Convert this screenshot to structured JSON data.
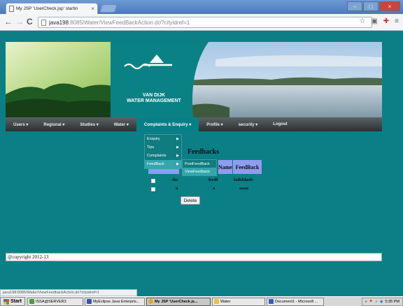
{
  "browser": {
    "tab_title": "My JSP 'UserCheck.jsp' startin",
    "tab_close": "×",
    "window_buttons": [
      "–",
      "□",
      "×"
    ],
    "nav": {
      "back": "←",
      "forward": "→",
      "reload": "C"
    },
    "url_host": "java198",
    "url_rest": ":8085/Water/ViewFeedBackAction.do?cityidref=1",
    "toolbar_icons": [
      "☆",
      "▣",
      "✚",
      "≡"
    ]
  },
  "logo": {
    "line1": "VAN DIJK",
    "line2": "WATER MANAGEMENT"
  },
  "menu": [
    {
      "label": "Users ▾",
      "active": false
    },
    {
      "label": "Regional ▾",
      "active": false
    },
    {
      "label": "Studies ▾",
      "active": false
    },
    {
      "label": "Water ▾",
      "active": false
    },
    {
      "label": "Complaints & Enquiry ▾",
      "active": true
    },
    {
      "label": "Profile ▾",
      "active": false
    },
    {
      "label": "security ▾",
      "active": false
    },
    {
      "label": "Logout",
      "active": false
    }
  ],
  "dropdown": [
    {
      "label": "Enquiry",
      "arrow": "▶"
    },
    {
      "label": "Tips",
      "arrow": "▶"
    },
    {
      "label": "Complaints",
      "arrow": "▶"
    },
    {
      "label": "FeedBack",
      "arrow": "▶"
    }
  ],
  "submenu": [
    {
      "label": "PostFeedBack"
    },
    {
      "label": "ViewFeedback"
    }
  ],
  "feedback": {
    "title": "Feedbacks",
    "headers": [
      "FeedBack",
      "Name",
      "FeedBack"
    ],
    "rows": [
      {
        "col1": "dss",
        "name": "fsedf",
        "feedback": "fadsfdasfs"
      },
      {
        "col1": "a",
        "name": "a",
        "feedback": "aaaa"
      }
    ],
    "delete_label": "Delete"
  },
  "footer": {
    "copyright": "@copyright 2012-13"
  },
  "status_url": "java198:8085/Water/ViewFeedbackAction.do?cityidref=1",
  "taskbar": {
    "start": "Start",
    "tasks": [
      {
        "label": "ISSA@SERVER3",
        "active": false
      },
      {
        "label": "MyEclipse Java Enterpris...",
        "active": false
      },
      {
        "label": "My JSP 'UserCheck.js...",
        "active": true
      },
      {
        "label": "Water",
        "active": false
      },
      {
        "label": "Document1 - Microsoft ...",
        "active": false
      }
    ],
    "tray_icons": [
      "«",
      "⚑",
      "♫",
      "◉"
    ],
    "time": "5:35 PM"
  },
  "colors": {
    "page_bg": "#0b7f86",
    "menu_active": "#077f86",
    "table_header": "#8f9cf0",
    "logo_teal": "#0a8285"
  }
}
